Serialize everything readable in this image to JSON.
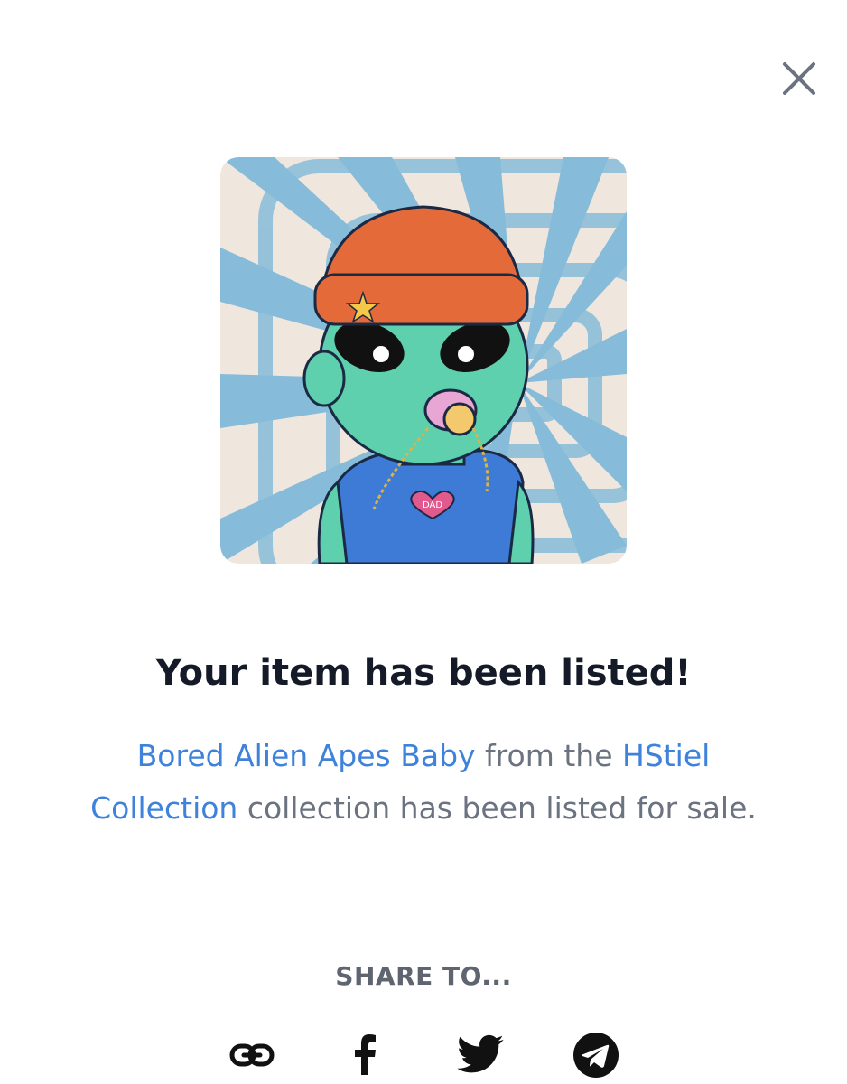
{
  "dialog": {
    "close_label": "Close",
    "title": "Your item has been listed!",
    "description": {
      "item_name": "Bored Alien Apes Baby",
      "text_1": " from the ",
      "collection_name": "HStiel Collection",
      "text_2": " collection has been listed for sale."
    },
    "share_heading": "SHARE TO...",
    "share_targets": [
      {
        "icon": "link-icon"
      },
      {
        "icon": "facebook-icon"
      },
      {
        "icon": "twitter-icon"
      },
      {
        "icon": "telegram-icon"
      }
    ]
  },
  "nft_image": {
    "shirt_text": "DAD",
    "description": "cartoon green alien baby with orange beanie, pacifier, blue tank top, on blue-white spiral background"
  },
  "colors": {
    "title": "#141a27",
    "body_text": "#6b7280",
    "link": "#3f82dc",
    "icon": "#111111",
    "close_icon": "#6b7280"
  }
}
